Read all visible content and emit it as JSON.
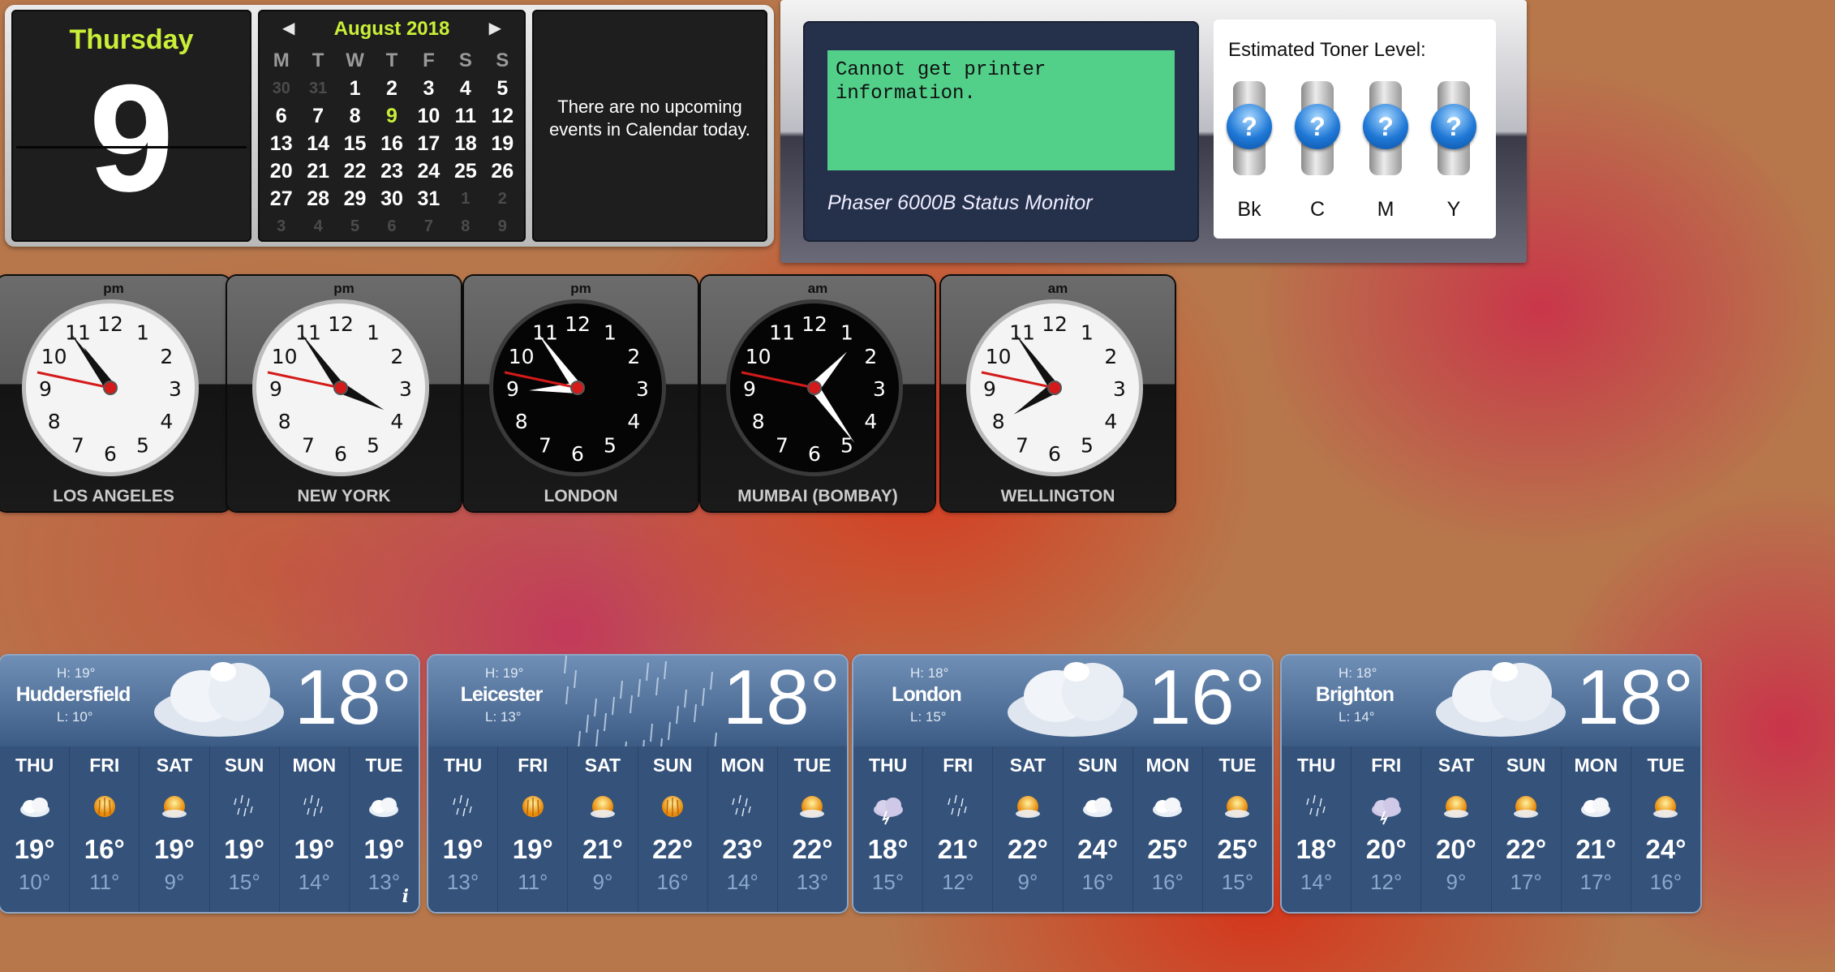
{
  "calendar": {
    "weekday": "Thursday",
    "date": "9",
    "month_title": "August 2018",
    "prev_icon": "chevron-left",
    "next_icon": "chevron-right",
    "day_headers": [
      "M",
      "T",
      "W",
      "T",
      "F",
      "S",
      "S"
    ],
    "weeks": [
      [
        {
          "d": "30",
          "dim": true
        },
        {
          "d": "31",
          "dim": true
        },
        {
          "d": "1"
        },
        {
          "d": "2"
        },
        {
          "d": "3"
        },
        {
          "d": "4"
        },
        {
          "d": "5"
        }
      ],
      [
        {
          "d": "6"
        },
        {
          "d": "7"
        },
        {
          "d": "8"
        },
        {
          "d": "9",
          "today": true
        },
        {
          "d": "10"
        },
        {
          "d": "11"
        },
        {
          "d": "12"
        }
      ],
      [
        {
          "d": "13"
        },
        {
          "d": "14"
        },
        {
          "d": "15"
        },
        {
          "d": "16"
        },
        {
          "d": "17"
        },
        {
          "d": "18"
        },
        {
          "d": "19"
        }
      ],
      [
        {
          "d": "20"
        },
        {
          "d": "21"
        },
        {
          "d": "22"
        },
        {
          "d": "23"
        },
        {
          "d": "24"
        },
        {
          "d": "25"
        },
        {
          "d": "26"
        }
      ],
      [
        {
          "d": "27"
        },
        {
          "d": "28"
        },
        {
          "d": "29"
        },
        {
          "d": "30"
        },
        {
          "d": "31"
        },
        {
          "d": "1",
          "dim": true
        },
        {
          "d": "2",
          "dim": true
        }
      ],
      [
        {
          "d": "3",
          "dim": true
        },
        {
          "d": "4",
          "dim": true
        },
        {
          "d": "5",
          "dim": true
        },
        {
          "d": "6",
          "dim": true
        },
        {
          "d": "7",
          "dim": true
        },
        {
          "d": "8",
          "dim": true
        },
        {
          "d": "9",
          "dim": true
        }
      ]
    ],
    "events_text": "There are no upcoming events in Calendar today."
  },
  "printer": {
    "message": "Cannot get printer\ninformation.",
    "name": "Phaser 6000B Status Monitor",
    "toner_title": "Estimated Toner Level:",
    "cartridges": [
      {
        "label": "Bk",
        "status_icon": "question-icon",
        "symbol": "?"
      },
      {
        "label": "C",
        "status_icon": "question-icon",
        "symbol": "?"
      },
      {
        "label": "M",
        "status_icon": "question-icon",
        "symbol": "?"
      },
      {
        "label": "Y",
        "status_icon": "question-icon",
        "symbol": "?"
      }
    ]
  },
  "clocks": [
    {
      "city": "LOS ANGELES",
      "ampm": "pm",
      "face": "light",
      "hour": 10.9,
      "minute": 54,
      "second": 47
    },
    {
      "city": "NEW YORK",
      "ampm": "pm",
      "face": "light",
      "hour": 3.9,
      "minute": 54,
      "second": 47
    },
    {
      "city": "LONDON",
      "ampm": "pm",
      "face": "dark",
      "hour": 8.9,
      "minute": 54,
      "second": 47
    },
    {
      "city": "MUMBAI (BOMBAY)",
      "ampm": "am",
      "face": "dark",
      "hour": 1.4,
      "minute": 24,
      "second": 47
    },
    {
      "city": "WELLINGTON",
      "ampm": "am",
      "face": "light",
      "hour": 7.9,
      "minute": 54,
      "second": 47
    }
  ],
  "weather": [
    {
      "city": "Huddersfield",
      "high": "H: 19°",
      "low": "L: 10°",
      "temp": "18°",
      "condition": "cloudy",
      "info_icon": "i",
      "days": [
        {
          "day": "THU",
          "icon": "cloud-icon",
          "hi": "19°",
          "lo": "10°"
        },
        {
          "day": "FRI",
          "icon": "sun-rain-icon",
          "hi": "16°",
          "lo": "11°"
        },
        {
          "day": "SAT",
          "icon": "sun-cloud-icon",
          "hi": "19°",
          "lo": "9°"
        },
        {
          "day": "SUN",
          "icon": "rain-icon",
          "hi": "19°",
          "lo": "15°"
        },
        {
          "day": "MON",
          "icon": "rain-icon",
          "hi": "19°",
          "lo": "14°"
        },
        {
          "day": "TUE",
          "icon": "cloud-icon",
          "hi": "19°",
          "lo": "13°"
        }
      ]
    },
    {
      "city": "Leicester",
      "high": "H: 19°",
      "low": "L: 13°",
      "temp": "18°",
      "condition": "rain",
      "days": [
        {
          "day": "THU",
          "icon": "rain-icon",
          "hi": "19°",
          "lo": "13°"
        },
        {
          "day": "FRI",
          "icon": "sun-rain-icon",
          "hi": "19°",
          "lo": "11°"
        },
        {
          "day": "SAT",
          "icon": "sun-cloud-icon",
          "hi": "21°",
          "lo": "9°"
        },
        {
          "day": "SUN",
          "icon": "sun-rain-icon",
          "hi": "22°",
          "lo": "16°"
        },
        {
          "day": "MON",
          "icon": "rain-icon",
          "hi": "23°",
          "lo": "14°"
        },
        {
          "day": "TUE",
          "icon": "sun-cloud-icon",
          "hi": "22°",
          "lo": "13°"
        }
      ]
    },
    {
      "city": "London",
      "high": "H: 18°",
      "low": "L: 15°",
      "temp": "16°",
      "condition": "cloudy",
      "days": [
        {
          "day": "THU",
          "icon": "thunder-icon",
          "hi": "18°",
          "lo": "15°"
        },
        {
          "day": "FRI",
          "icon": "rain-icon",
          "hi": "21°",
          "lo": "12°"
        },
        {
          "day": "SAT",
          "icon": "sun-cloud-icon",
          "hi": "22°",
          "lo": "9°"
        },
        {
          "day": "SUN",
          "icon": "cloud-icon",
          "hi": "24°",
          "lo": "16°"
        },
        {
          "day": "MON",
          "icon": "cloud-icon",
          "hi": "25°",
          "lo": "16°"
        },
        {
          "day": "TUE",
          "icon": "sun-cloud-icon",
          "hi": "25°",
          "lo": "15°"
        }
      ]
    },
    {
      "city": "Brighton",
      "high": "H: 18°",
      "low": "L: 14°",
      "temp": "18°",
      "condition": "cloudy",
      "days": [
        {
          "day": "THU",
          "icon": "rain-icon",
          "hi": "18°",
          "lo": "14°"
        },
        {
          "day": "FRI",
          "icon": "thunder-icon",
          "hi": "20°",
          "lo": "12°"
        },
        {
          "day": "SAT",
          "icon": "sun-cloud-icon",
          "hi": "20°",
          "lo": "9°"
        },
        {
          "day": "SUN",
          "icon": "sun-cloud-icon",
          "hi": "22°",
          "lo": "17°"
        },
        {
          "day": "MON",
          "icon": "cloud-icon",
          "hi": "21°",
          "lo": "17°"
        },
        {
          "day": "TUE",
          "icon": "sun-cloud-icon",
          "hi": "24°",
          "lo": "16°"
        }
      ]
    }
  ]
}
